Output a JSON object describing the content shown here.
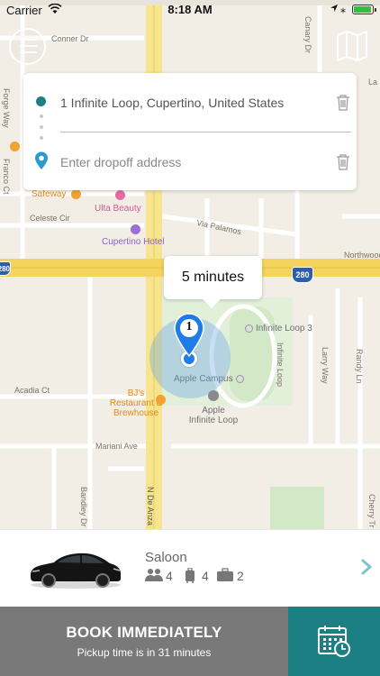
{
  "status_bar": {
    "carrier": "Carrier",
    "time": "8:18 AM"
  },
  "address": {
    "pickup": "1 Infinite Loop, Cupertino, United States",
    "dropoff_placeholder": "Enter dropoff address"
  },
  "map": {
    "streets": {
      "conner_dr": "Conner Dr",
      "forge_way": "Forge Way",
      "franco_ct": "Franco Ct",
      "celeste_cir": "Celeste Cir",
      "via_palamos": "Via Palamos",
      "northwood": "Northwood",
      "acadia_ct": "Acadia Ct",
      "mariani_ave": "Mariani Ave",
      "bandley_dr": "Bandley Dr",
      "n_de_anza": "N De Anza",
      "infinite_loop_street": "Infinite Loop",
      "larry_way": "Larry Way",
      "randy_ln": "Randy Ln",
      "cherry_tr": "Cherry Tr",
      "canary_dr": "Canary Dr",
      "lane_label": "La"
    },
    "highway_shield": "280",
    "highway_shield_left": "280",
    "pois": {
      "safeway": "Safeway",
      "ulta_beauty": "Ulta Beauty",
      "cupertino_hotel": "Cupertino Hotel",
      "infinite_loop_3": "Infinite Loop 3",
      "apple_campus": "Apple Campus",
      "bjs_line1": "BJ's",
      "bjs_line2": "Restaurant &",
      "bjs_line3": "Brewhouse",
      "apple_il_line1": "Apple",
      "apple_il_line2": "Infinite Loop"
    },
    "eta_callout": "5 minutes",
    "pickup_marker_number": "1"
  },
  "vehicle": {
    "name": "Saloon",
    "passengers": "4",
    "luggage": "4",
    "bags": "2"
  },
  "booking": {
    "title": "BOOK IMMEDIATELY",
    "subtitle": "Pickup time is in 31 minutes"
  },
  "colors": {
    "accent_teal": "#1b7f83",
    "book_gray": "#797979",
    "location_blue": "#1e7ce8",
    "chevron": "#7cc4d4"
  },
  "icons": {
    "menu": "hamburger-icon",
    "map": "folded-map-icon",
    "trash": "trash-icon",
    "dropoff_pin": "location-pin-icon",
    "passengers": "people-icon",
    "luggage": "suitcase-icon",
    "bags": "briefcase-icon",
    "next": "chevron-right-icon",
    "schedule": "calendar-clock-icon"
  }
}
